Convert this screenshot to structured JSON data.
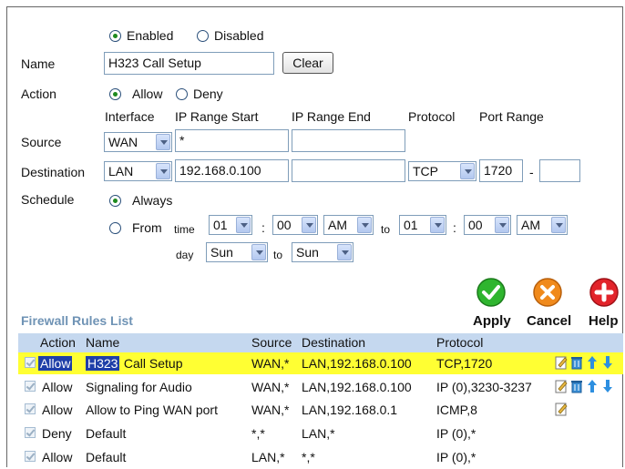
{
  "status": {
    "enabled": "Enabled",
    "disabled": "Disabled",
    "selected": "enabled"
  },
  "name": {
    "label": "Name",
    "value": "H323 Call Setup",
    "clear": "Clear"
  },
  "action": {
    "label": "Action",
    "allow": "Allow",
    "deny": "Deny",
    "selected": "allow"
  },
  "columns": {
    "interface": "Interface",
    "ip_start": "IP Range Start",
    "ip_end": "IP Range End",
    "protocol": "Protocol",
    "port_range": "Port Range"
  },
  "source": {
    "label": "Source",
    "interface": "WAN",
    "ip_start": "*",
    "ip_end": ""
  },
  "destination": {
    "label": "Destination",
    "interface": "LAN",
    "ip_start": "192.168.0.100",
    "ip_end": "",
    "protocol": "TCP",
    "port_start": "1720",
    "port_sep": "-",
    "port_end": ""
  },
  "schedule": {
    "label": "Schedule",
    "always": "Always",
    "from": "From",
    "time_label": "time",
    "from_hour": "01",
    "from_min": "00",
    "from_ampm": "AM",
    "to_label": "to",
    "to_hour": "01",
    "to_min": "00",
    "to_ampm": "AM",
    "colon": ":",
    "day_label": "day",
    "from_day": "Sun",
    "day_to_label": "to",
    "to_day": "Sun",
    "selected": "always"
  },
  "toolbar": {
    "apply": "Apply",
    "cancel": "Cancel",
    "help": "Help"
  },
  "list": {
    "title": "Firewall Rules List",
    "headers": {
      "action": "Action",
      "name": "Name",
      "source": "Source",
      "destination": "Destination",
      "protocol": "Protocol"
    },
    "rows": [
      {
        "action": "Allow",
        "name_hl": "H323",
        "name": " Call Setup",
        "source": "WAN,*",
        "destination": "LAN,192.168.0.100",
        "protocol": "TCP,1720",
        "checked": true
      },
      {
        "action": "Allow",
        "name": "Signaling for Audio",
        "source": "WAN,*",
        "destination": "LAN,192.168.0.100",
        "protocol": "IP (0),3230-3237",
        "checked": true
      },
      {
        "action": "Allow",
        "name": "Allow to Ping WAN port",
        "source": "WAN,*",
        "destination": "LAN,192.168.0.1",
        "protocol": "ICMP,8",
        "checked": true
      },
      {
        "action": "Deny",
        "name": "Default",
        "source": "*,*",
        "destination": "LAN,*",
        "protocol": "IP (0),*",
        "checked": true
      },
      {
        "action": "Allow",
        "name": "Default",
        "source": "LAN,*",
        "destination": "*,*",
        "protocol": "IP (0),*",
        "checked": true
      }
    ]
  },
  "colors": {
    "highlight": "#ffff33",
    "header_bg": "#c5d8ef",
    "title": "#6f93b5",
    "apply": "#2fb52f",
    "cancel": "#f08a1c",
    "help": "#e2232a"
  }
}
